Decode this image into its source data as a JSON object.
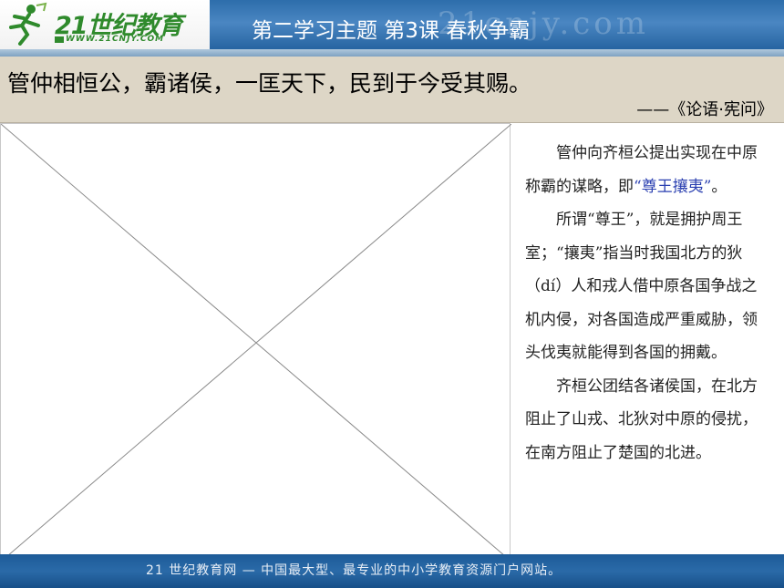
{
  "header": {
    "logo_text": "21世纪教育",
    "logo_url": "WWW.21CNJY.COM",
    "watermark": "21cnjy.com",
    "title": "第二学习主题  第3课  春秋争霸"
  },
  "quote": {
    "text": "管仲相恒公，霸诸侯，一匡天下，民到于今受其赐。",
    "source": "——《论语·宪问》"
  },
  "body": {
    "p1_before": "管仲向齐桓公提出实现在中原称霸的谋略，即",
    "p1_highlight": "“尊王攘夷”",
    "p1_after": "。",
    "p2": "所谓“尊王”，就是拥护周王室；“攘夷”指当时我国北方的狄（dí）人和戎人借中原各国争战之机内侵，对各国造成严重威胁，领头伐夷就能得到各国的拥戴。",
    "p3": "齐桓公团结各诸侯国，在北方阻止了山戎、北狄对中原的侵扰，在南方阻止了楚国的北进。"
  },
  "footer": {
    "text": "21 世纪教育网 — 中国最大型、最专业的中小学教育资源门户网站。"
  },
  "colors": {
    "header_blue": "#2d6dab",
    "quote_band": "#ddd6c6",
    "highlight": "#2a3fb0",
    "logo_green": "#2f8a2c"
  }
}
